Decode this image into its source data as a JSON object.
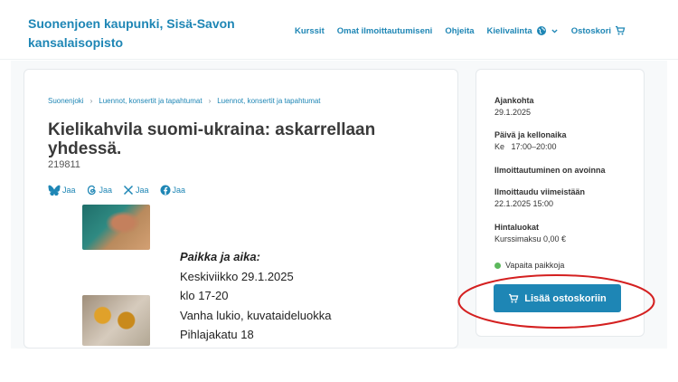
{
  "header": {
    "brand": "Suonenjoen kaupunki, Sisä-Savon kansalaisopisto",
    "nav": {
      "courses": "Kurssit",
      "my_registrations": "Omat ilmoittautumiseni",
      "help": "Ohjeita",
      "language": "Kielivalinta",
      "cart": "Ostoskori"
    }
  },
  "breadcrumb": {
    "item1": "Suonenjoki",
    "item2": "Luennot, konsertit ja tapahtumat",
    "item3": "Luennot, konsertit ja tapahtumat"
  },
  "course": {
    "title": "Kielikahvila suomi-ukraina: askarrellaan yhdessä.",
    "code": "219811"
  },
  "share": {
    "bluesky": "Jaa",
    "threads": "Jaa",
    "x": "Jaa",
    "facebook": "Jaa"
  },
  "description": {
    "heading": "Paikka ja aika:",
    "line1": "Keskiviikko 29.1.2025",
    "line2": "klo 17-20",
    "line3": "Vanha lukio, kuvataideluokka",
    "line4": "Pihlajakatu 18"
  },
  "sidebar": {
    "date_label": "Ajankohta",
    "date_value": "29.1.2025",
    "time_label": "Päivä ja kellonaika",
    "time_value": "Ke   17:00–20:00",
    "registration_open": "Ilmoittautuminen on avoinna",
    "deadline_label": "Ilmoittaudu viimeistään",
    "deadline_value": "22.1.2025 15:00",
    "price_label": "Hintaluokat",
    "price_value": "Kurssimaksu 0,00 €",
    "availability": "Vapaita paikkoja",
    "add_to_cart": "Lisää ostoskoriin"
  },
  "colors": {
    "brand": "#1e86b5",
    "available": "#5cb85c",
    "annotation": "#d42020"
  }
}
